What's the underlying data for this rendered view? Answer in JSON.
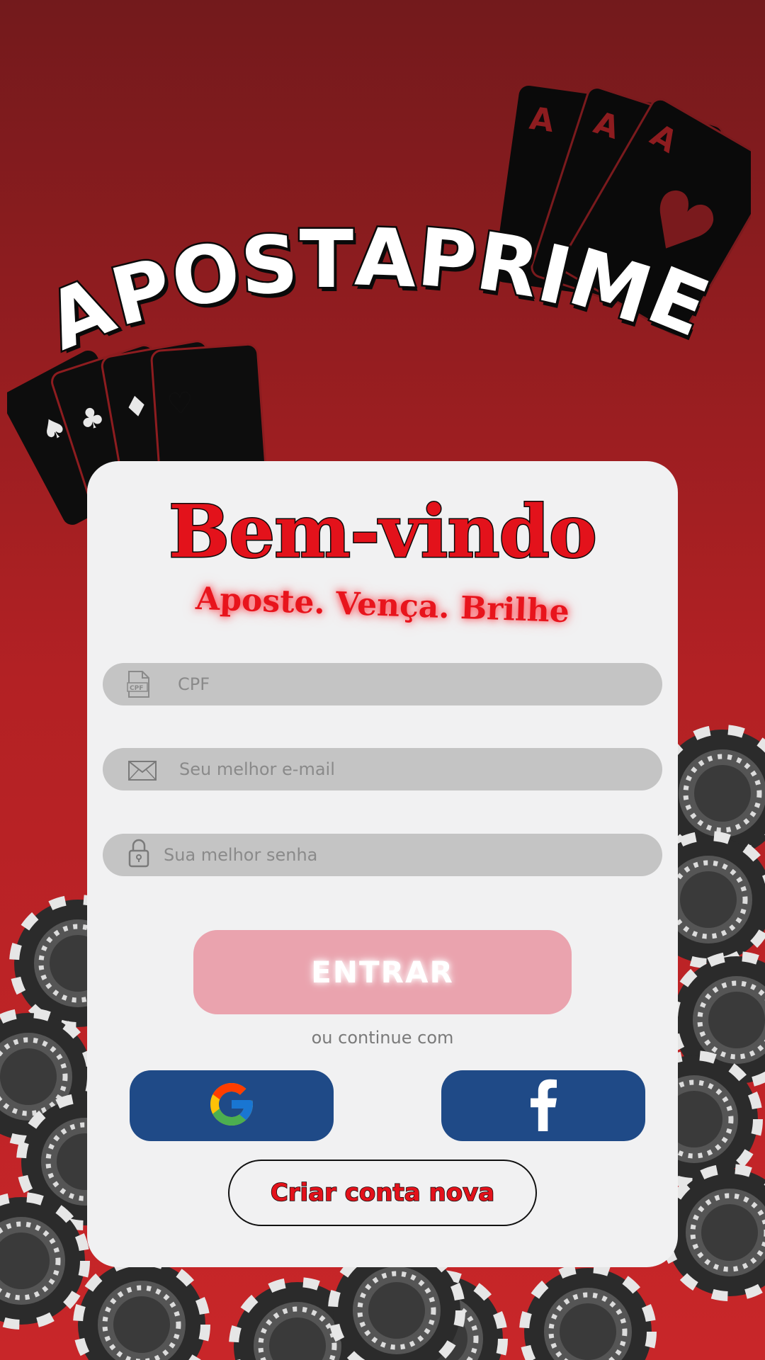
{
  "brand": {
    "logo_text": "APOSTAPRIME",
    "logo_colors": {
      "fill": "#ffffff",
      "outline": "#0a0a0a"
    }
  },
  "card": {
    "title": "Bem-vindo",
    "subtitle": "Aposte. Vença. Brilhe"
  },
  "form": {
    "cpf": {
      "placeholder": "CPF",
      "value": "",
      "icon": "cpf-document-icon"
    },
    "email": {
      "placeholder": "Seu melhor e-mail",
      "value": "",
      "icon": "envelope-icon"
    },
    "password": {
      "placeholder": "Sua melhor senha",
      "value": "",
      "icon": "padlock-icon"
    }
  },
  "actions": {
    "login_label": "ENTRAR",
    "alt_text": "ou continue com",
    "google_icon": "google-icon",
    "facebook_icon": "facebook-icon",
    "create_account_label": "Criar conta nova"
  },
  "colors": {
    "background": "#b32124",
    "card": "#f1f1f2",
    "accent_red": "#e3121b",
    "login_button": "#eaa3ae",
    "social_button": "#1f4a87",
    "field": "#c4c4c4"
  }
}
